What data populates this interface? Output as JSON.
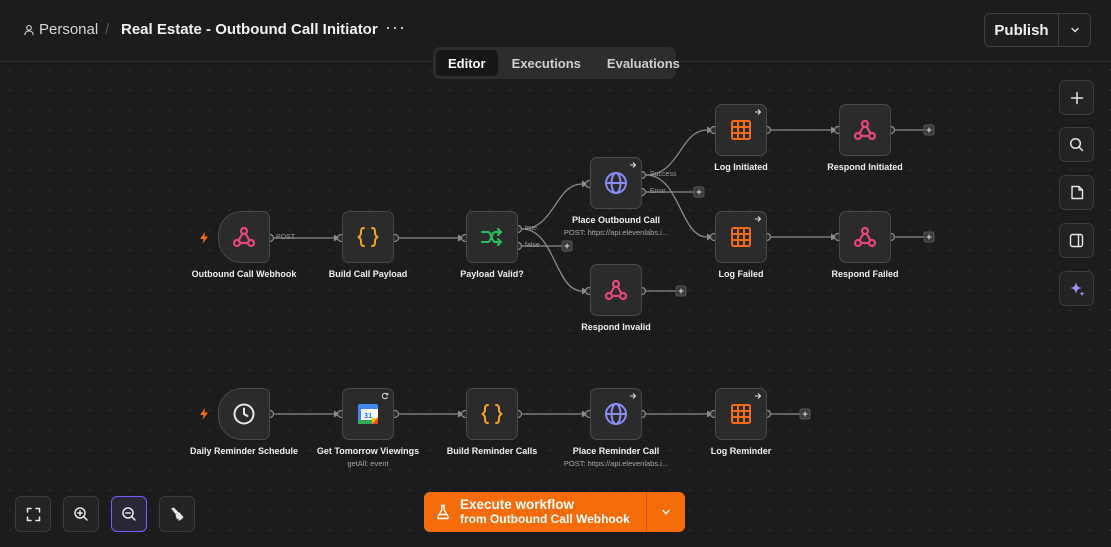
{
  "header": {
    "workspace": "Personal",
    "separator": "/",
    "title": "Real Estate - Outbound Call Initiator",
    "more": "···",
    "publish_label": "Publish"
  },
  "tabs": [
    {
      "label": "Editor",
      "active": true
    },
    {
      "label": "Executions",
      "active": false
    },
    {
      "label": "Evaluations",
      "active": false
    }
  ],
  "nodes": {
    "outbound_webhook": {
      "label": "Outbound Call Webhook",
      "icon": "webhook-icon"
    },
    "build_call_payload": {
      "label": "Build Call Payload",
      "icon": "code-braces-icon"
    },
    "payload_valid": {
      "label": "Payload Valid?",
      "icon": "branch-if-icon"
    },
    "place_outbound_call": {
      "label": "Place Outbound Call",
      "sub": "POST: https://api.elevenlabs.i...",
      "icon": "globe-icon"
    },
    "respond_invalid": {
      "label": "Respond Invalid",
      "icon": "webhook-icon"
    },
    "log_initiated": {
      "label": "Log Initiated",
      "icon": "table-icon"
    },
    "respond_initiated": {
      "label": "Respond Initiated",
      "icon": "webhook-icon"
    },
    "log_failed": {
      "label": "Log Failed",
      "icon": "table-icon"
    },
    "respond_failed": {
      "label": "Respond Failed",
      "icon": "webhook-icon"
    },
    "daily_reminder_schedule": {
      "label": "Daily Reminder Schedule",
      "icon": "clock-icon"
    },
    "get_tomorrow_viewings": {
      "label": "Get Tomorrow Viewings",
      "sub": "getAll: event",
      "icon": "google-calendar-icon",
      "calendar_day": "31"
    },
    "build_reminder_calls": {
      "label": "Build Reminder Calls",
      "icon": "code-braces-icon"
    },
    "place_reminder_call": {
      "label": "Place Reminder Call",
      "sub": "POST: https://api.elevenlabs.i...",
      "icon": "globe-icon"
    },
    "log_reminder": {
      "label": "Log Reminder",
      "icon": "table-icon"
    }
  },
  "connection_labels": {
    "post": "POST",
    "true": "true",
    "false": "false",
    "success": "Success",
    "error": "Error"
  },
  "execute": {
    "title": "Execute workflow",
    "subtitle": "from Outbound Call Webhook"
  },
  "colors": {
    "accent": "#f56c0a",
    "webhook": "#e8477a",
    "code": "#f5a623",
    "branch": "#22c55e",
    "globe": "#8b8cf5",
    "table": "#f26b1d",
    "ai": "#a78bfa"
  }
}
